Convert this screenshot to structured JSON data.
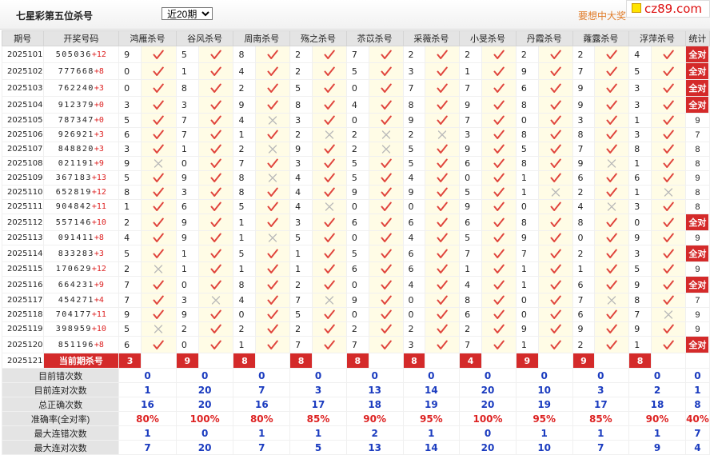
{
  "header": {
    "title": "七星彩第五位杀号",
    "select_value": "近20期",
    "select_options": [
      "近20期"
    ],
    "promo_text": "要想中大奖",
    "logo_text": "cz89.com"
  },
  "columns": {
    "period": "期号",
    "number": "开奖号码",
    "killers": [
      "鸿雁杀号",
      "谷风杀号",
      "周南杀号",
      "殇之杀号",
      "苶苡杀号",
      "采薇杀号",
      "小旻杀号",
      "丹霞杀号",
      "蕹露杀号",
      "浮萍杀号"
    ],
    "stat": "统计"
  },
  "rows": [
    {
      "p": "2025101",
      "n": "505036",
      "s": "+12",
      "k": [
        "9",
        "5",
        "8",
        "2",
        "7",
        "2",
        "2",
        "2",
        "2",
        "4"
      ],
      "m": [
        1,
        1,
        1,
        1,
        1,
        1,
        1,
        1,
        1,
        1
      ],
      "st": "全对"
    },
    {
      "p": "2025102",
      "n": "777668",
      "s": "+8",
      "k": [
        "0",
        "1",
        "4",
        "2",
        "5",
        "3",
        "1",
        "9",
        "7",
        "5"
      ],
      "m": [
        1,
        1,
        1,
        1,
        1,
        1,
        1,
        1,
        1,
        1
      ],
      "st": "全对"
    },
    {
      "p": "2025103",
      "n": "762240",
      "s": "+3",
      "k": [
        "0",
        "8",
        "2",
        "5",
        "0",
        "7",
        "7",
        "6",
        "9",
        "3"
      ],
      "m": [
        1,
        1,
        1,
        1,
        1,
        1,
        1,
        1,
        1,
        1
      ],
      "st": "全对"
    },
    {
      "p": "2025104",
      "n": "912379",
      "s": "+0",
      "k": [
        "3",
        "3",
        "9",
        "8",
        "4",
        "8",
        "9",
        "8",
        "9",
        "3"
      ],
      "m": [
        1,
        1,
        1,
        1,
        1,
        1,
        1,
        1,
        1,
        1
      ],
      "st": "全对"
    },
    {
      "p": "2025105",
      "n": "787347",
      "s": "+0",
      "k": [
        "5",
        "7",
        "4",
        "3",
        "0",
        "9",
        "7",
        "0",
        "3",
        "1"
      ],
      "m": [
        1,
        1,
        0,
        1,
        1,
        1,
        1,
        1,
        1,
        1
      ],
      "st": "9"
    },
    {
      "p": "2025106",
      "n": "926921",
      "s": "+3",
      "k": [
        "6",
        "7",
        "1",
        "2",
        "2",
        "2",
        "3",
        "8",
        "8",
        "3"
      ],
      "m": [
        1,
        1,
        1,
        0,
        0,
        0,
        1,
        1,
        1,
        1
      ],
      "st": "7"
    },
    {
      "p": "2025107",
      "n": "848820",
      "s": "+3",
      "k": [
        "3",
        "1",
        "2",
        "9",
        "2",
        "5",
        "9",
        "5",
        "7",
        "8"
      ],
      "m": [
        1,
        1,
        0,
        1,
        0,
        1,
        1,
        1,
        1,
        1
      ],
      "st": "8"
    },
    {
      "p": "2025108",
      "n": "021191",
      "s": "+9",
      "k": [
        "9",
        "0",
        "7",
        "3",
        "5",
        "5",
        "6",
        "8",
        "9",
        "1"
      ],
      "m": [
        0,
        1,
        1,
        1,
        1,
        1,
        1,
        1,
        0,
        1
      ],
      "st": "8"
    },
    {
      "p": "2025109",
      "n": "367183",
      "s": "+13",
      "k": [
        "5",
        "9",
        "8",
        "4",
        "5",
        "4",
        "0",
        "1",
        "6",
        "6"
      ],
      "m": [
        1,
        1,
        0,
        1,
        1,
        1,
        1,
        1,
        1,
        1
      ],
      "st": "9"
    },
    {
      "p": "2025110",
      "n": "652819",
      "s": "+12",
      "k": [
        "8",
        "3",
        "8",
        "4",
        "9",
        "9",
        "5",
        "1",
        "2",
        "1"
      ],
      "m": [
        1,
        1,
        1,
        1,
        1,
        1,
        1,
        0,
        1,
        0
      ],
      "st": "8"
    },
    {
      "p": "2025111",
      "n": "904842",
      "s": "+11",
      "k": [
        "1",
        "6",
        "5",
        "4",
        "0",
        "0",
        "9",
        "0",
        "4",
        "3"
      ],
      "m": [
        1,
        1,
        1,
        0,
        1,
        1,
        1,
        1,
        0,
        1
      ],
      "st": "8"
    },
    {
      "p": "2025112",
      "n": "557146",
      "s": "+10",
      "k": [
        "2",
        "9",
        "1",
        "3",
        "6",
        "6",
        "6",
        "8",
        "8",
        "0"
      ],
      "m": [
        1,
        1,
        1,
        1,
        1,
        1,
        1,
        1,
        1,
        1
      ],
      "st": "全对"
    },
    {
      "p": "2025113",
      "n": "091411",
      "s": "+8",
      "k": [
        "4",
        "9",
        "1",
        "5",
        "0",
        "4",
        "5",
        "9",
        "0",
        "9"
      ],
      "m": [
        1,
        1,
        0,
        1,
        1,
        1,
        1,
        1,
        1,
        1
      ],
      "st": "9"
    },
    {
      "p": "2025114",
      "n": "833283",
      "s": "+3",
      "k": [
        "5",
        "1",
        "5",
        "1",
        "5",
        "6",
        "7",
        "7",
        "2",
        "3"
      ],
      "m": [
        1,
        1,
        1,
        1,
        1,
        1,
        1,
        1,
        1,
        1
      ],
      "st": "全对"
    },
    {
      "p": "2025115",
      "n": "170629",
      "s": "+12",
      "k": [
        "2",
        "1",
        "1",
        "1",
        "6",
        "6",
        "1",
        "1",
        "1",
        "5"
      ],
      "m": [
        0,
        1,
        1,
        1,
        1,
        1,
        1,
        1,
        1,
        1
      ],
      "st": "9"
    },
    {
      "p": "2025116",
      "n": "664231",
      "s": "+9",
      "k": [
        "7",
        "0",
        "8",
        "2",
        "0",
        "4",
        "4",
        "1",
        "6",
        "9"
      ],
      "m": [
        1,
        1,
        1,
        1,
        1,
        1,
        1,
        1,
        1,
        1
      ],
      "st": "全对"
    },
    {
      "p": "2025117",
      "n": "454271",
      "s": "+4",
      "k": [
        "7",
        "3",
        "4",
        "7",
        "9",
        "0",
        "8",
        "0",
        "7",
        "8"
      ],
      "m": [
        1,
        0,
        1,
        0,
        1,
        1,
        1,
        1,
        0,
        1
      ],
      "st": "7"
    },
    {
      "p": "2025118",
      "n": "704177",
      "s": "+11",
      "k": [
        "9",
        "9",
        "0",
        "5",
        "0",
        "0",
        "6",
        "0",
        "6",
        "7"
      ],
      "m": [
        1,
        1,
        1,
        1,
        1,
        1,
        1,
        1,
        1,
        0
      ],
      "st": "9"
    },
    {
      "p": "2025119",
      "n": "398959",
      "s": "+10",
      "k": [
        "5",
        "2",
        "2",
        "2",
        "2",
        "2",
        "2",
        "9",
        "9",
        "9"
      ],
      "m": [
        0,
        1,
        1,
        1,
        1,
        1,
        1,
        1,
        1,
        1
      ],
      "st": "9"
    },
    {
      "p": "2025120",
      "n": "851196",
      "s": "+8",
      "k": [
        "6",
        "0",
        "1",
        "7",
        "7",
        "3",
        "7",
        "1",
        "2",
        "1"
      ],
      "m": [
        1,
        1,
        1,
        1,
        1,
        1,
        1,
        1,
        1,
        1
      ],
      "st": "全对"
    }
  ],
  "current": {
    "period": "2025121",
    "label": "当前期杀号",
    "kills": [
      "3",
      "9",
      "8",
      "8",
      "8",
      "8",
      "4",
      "9",
      "9",
      "8"
    ]
  },
  "stats": [
    {
      "label": "目前错次数",
      "values": [
        "0",
        "0",
        "0",
        "0",
        "0",
        "0",
        "0",
        "0",
        "0",
        "0",
        "0"
      ]
    },
    {
      "label": "目前连对次数",
      "values": [
        "1",
        "20",
        "7",
        "3",
        "13",
        "14",
        "20",
        "10",
        "3",
        "2",
        "1"
      ]
    },
    {
      "label": "总正确次数",
      "values": [
        "16",
        "20",
        "16",
        "17",
        "18",
        "19",
        "20",
        "19",
        "17",
        "18",
        "8"
      ]
    },
    {
      "label": "准确率(全对率)",
      "values": [
        "80%",
        "100%",
        "80%",
        "85%",
        "90%",
        "95%",
        "100%",
        "95%",
        "85%",
        "90%",
        "40%"
      ],
      "pct": true
    },
    {
      "label": "最大连错次数",
      "values": [
        "1",
        "0",
        "1",
        "1",
        "2",
        "1",
        "0",
        "1",
        "1",
        "1",
        "7"
      ]
    },
    {
      "label": "最大连对次数",
      "values": [
        "7",
        "20",
        "7",
        "5",
        "13",
        "14",
        "20",
        "10",
        "7",
        "9",
        "4"
      ]
    }
  ],
  "colors": {
    "check": "#e0453d",
    "cross": "#b9b9b9",
    "accent": "#d42a2a",
    "stat_blue": "#1a3bbf",
    "promo": "#e07b28"
  }
}
